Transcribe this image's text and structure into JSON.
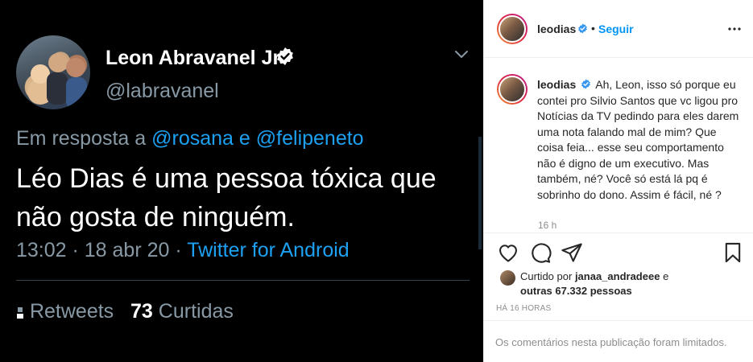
{
  "tweet": {
    "name": "Leon Abravanel Jr",
    "handle": "@labravanel",
    "reply_prefix": "Em resposta a",
    "reply_mention_1": "@rosana",
    "reply_joiner": "e",
    "reply_mention_2": "@felipeneto",
    "text": "Léo Dias é uma pessoa tóxica que não gosta de ninguém.",
    "time": "13:02 · 18 abr 20 ·",
    "source": "Twitter for Android",
    "retweets_label": "Retweets",
    "likes_count": "73",
    "likes_label": "Curtidas",
    "colors": {
      "background": "#000000",
      "accent": "#1da1f2",
      "muted": "#8899a6"
    }
  },
  "post": {
    "username": "leodias",
    "dot": "•",
    "follow_label": "Seguir",
    "more_icon": "more-horizontal-icon",
    "caption_user": "leodias",
    "caption": "Ah, Leon, isso só porque eu contei pro Silvio Santos que vc ligou pro Notícias da TV pedindo para eles darem uma nota falando mal de mim? Que coisa feia... esse seu comportamento não é digno de um executivo. Mas também, né? Você só está lá pq é sobrinho do dono. Assim é fácil, né ?",
    "caption_age": "16 h",
    "liked_by_prefix": "Curtido por",
    "liked_by_user": "janaa_andradeee",
    "liked_by_joiner": "e",
    "liked_by_others": "outras 67.332 pessoas",
    "timestamp": "HÁ 16 HORAS",
    "comments_limited": "Os comentários nesta publicação foram limitados.",
    "colors": {
      "link": "#0095f6",
      "text": "#262626",
      "muted": "#8e8e8e",
      "verified": "#3897f0"
    }
  }
}
